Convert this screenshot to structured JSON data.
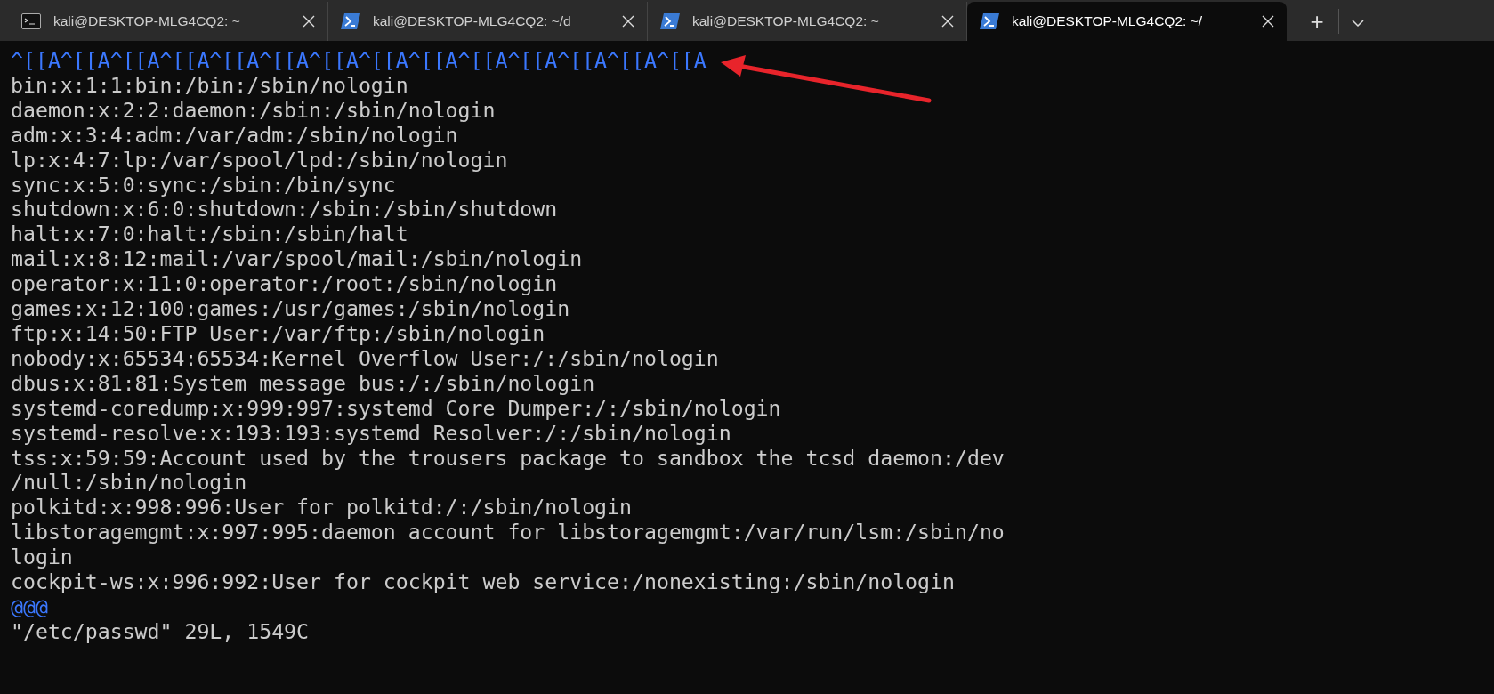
{
  "tabs": [
    {
      "kind": "cmd",
      "title": "kali@DESKTOP-MLG4CQ2: ~",
      "selected": false
    },
    {
      "kind": "shell",
      "title": "kali@DESKTOP-MLG4CQ2: ~/d",
      "selected": false
    },
    {
      "kind": "shell",
      "title": "kali@DESKTOP-MLG4CQ2: ~",
      "selected": false
    },
    {
      "kind": "shell",
      "title": "kali@DESKTOP-MLG4CQ2: ~/",
      "selected": true
    }
  ],
  "new_tab": "+",
  "terminal": {
    "lines": [
      {
        "kind": "escape",
        "text": "^[[A^[[A^[[A^[[A^[[A^[[A^[[A^[[A^[[A^[[A^[[A^[[A^[[A^[[A"
      },
      {
        "kind": "output",
        "text": "bin:x:1:1:bin:/bin:/sbin/nologin"
      },
      {
        "kind": "output",
        "text": "daemon:x:2:2:daemon:/sbin:/sbin/nologin"
      },
      {
        "kind": "output",
        "text": "adm:x:3:4:adm:/var/adm:/sbin/nologin"
      },
      {
        "kind": "output",
        "text": "lp:x:4:7:lp:/var/spool/lpd:/sbin/nologin"
      },
      {
        "kind": "output",
        "text": "sync:x:5:0:sync:/sbin:/bin/sync"
      },
      {
        "kind": "output",
        "text": "shutdown:x:6:0:shutdown:/sbin:/sbin/shutdown"
      },
      {
        "kind": "output",
        "text": "halt:x:7:0:halt:/sbin:/sbin/halt"
      },
      {
        "kind": "output",
        "text": "mail:x:8:12:mail:/var/spool/mail:/sbin/nologin"
      },
      {
        "kind": "output",
        "text": "operator:x:11:0:operator:/root:/sbin/nologin"
      },
      {
        "kind": "output",
        "text": "games:x:12:100:games:/usr/games:/sbin/nologin"
      },
      {
        "kind": "output",
        "text": "ftp:x:14:50:FTP User:/var/ftp:/sbin/nologin"
      },
      {
        "kind": "output",
        "text": "nobody:x:65534:65534:Kernel Overflow User:/:/sbin/nologin"
      },
      {
        "kind": "output",
        "text": "dbus:x:81:81:System message bus:/:/sbin/nologin"
      },
      {
        "kind": "output",
        "text": "systemd-coredump:x:999:997:systemd Core Dumper:/:/sbin/nologin"
      },
      {
        "kind": "output",
        "text": "systemd-resolve:x:193:193:systemd Resolver:/:/sbin/nologin"
      },
      {
        "kind": "output",
        "text": "tss:x:59:59:Account used by the trousers package to sandbox the tcsd daemon:/dev"
      },
      {
        "kind": "output",
        "text": "/null:/sbin/nologin"
      },
      {
        "kind": "output",
        "text": "polkitd:x:998:996:User for polkitd:/:/sbin/nologin"
      },
      {
        "kind": "output",
        "text": "libstoragemgmt:x:997:995:daemon account for libstoragemgmt:/var/run/lsm:/sbin/no"
      },
      {
        "kind": "output",
        "text": "login"
      },
      {
        "kind": "output",
        "text": "cockpit-ws:x:996:992:User for cockpit web service:/nonexisting:/sbin/nologin"
      },
      {
        "kind": "escape",
        "text": "@@@"
      },
      {
        "kind": "output",
        "text": "\"/etc/passwd\" 29L, 1549C"
      }
    ]
  }
}
